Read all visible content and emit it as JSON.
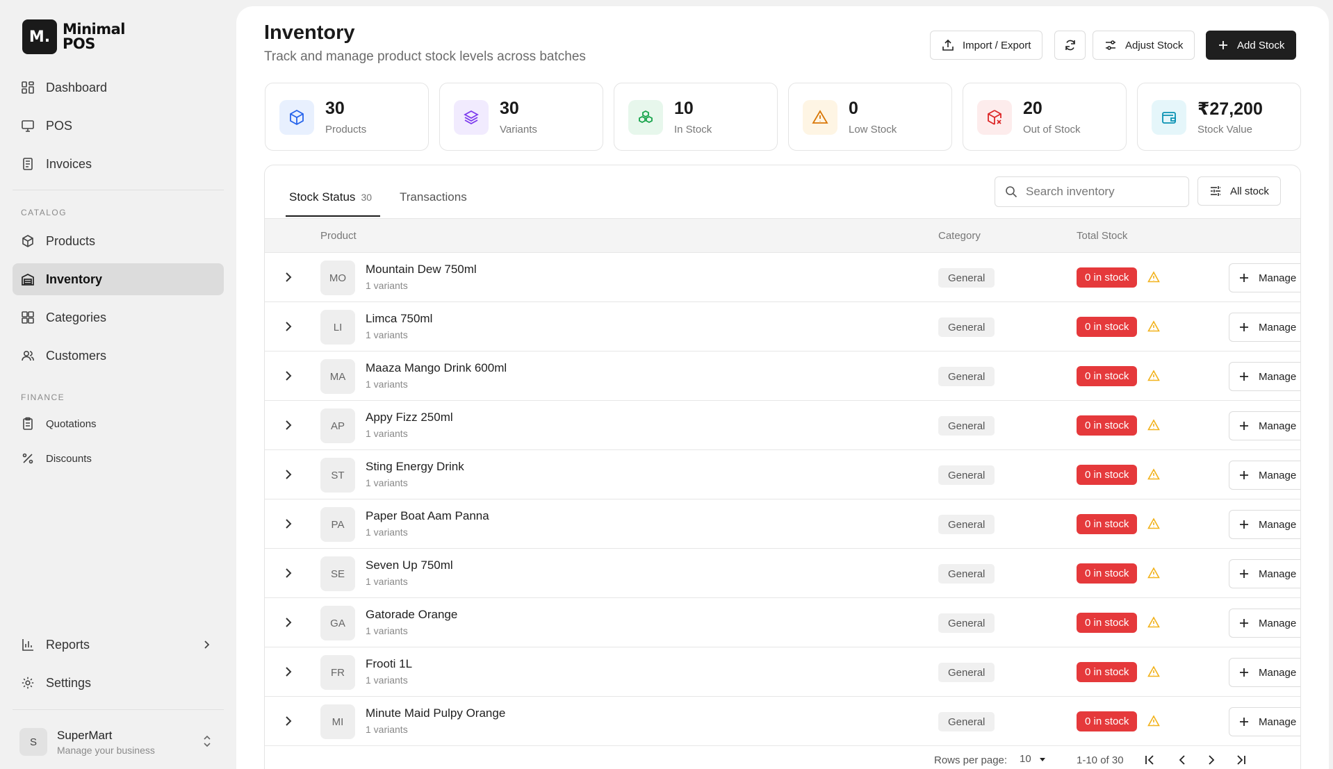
{
  "brand": {
    "logo_mark": "M.",
    "name_line1": "Minimal",
    "name_line2": "POS"
  },
  "sidebar": {
    "primary": [
      {
        "label": "Dashboard",
        "icon": "grid-icon"
      },
      {
        "label": "POS",
        "icon": "monitor-icon"
      },
      {
        "label": "Invoices",
        "icon": "receipt-icon"
      }
    ],
    "catalog_heading": "CATALOG",
    "catalog": [
      {
        "label": "Products",
        "icon": "box-icon"
      },
      {
        "label": "Inventory",
        "icon": "warehouse-icon",
        "active": true
      },
      {
        "label": "Categories",
        "icon": "grid-icon"
      },
      {
        "label": "Customers",
        "icon": "users-icon"
      }
    ],
    "finance_heading": "FINANCE",
    "finance": [
      {
        "label": "Quotations",
        "icon": "clipboard-icon"
      },
      {
        "label": "Discounts",
        "icon": "percent-icon"
      }
    ],
    "bottom": [
      {
        "label": "Reports",
        "icon": "bar-chart-icon"
      },
      {
        "label": "Settings",
        "icon": "gear-icon"
      }
    ],
    "business": {
      "initial": "S",
      "name": "SuperMart",
      "subtitle": "Manage your business"
    }
  },
  "header": {
    "title": "Inventory",
    "subtitle": "Track and manage product stock levels across batches",
    "import_export_label": "Import / Export",
    "adjust_stock_label": "Adjust Stock",
    "add_stock_label": "Add Stock"
  },
  "stats": [
    {
      "value": "30",
      "label": "Products",
      "color": "#2563eb",
      "bg": "#e8f0fe",
      "icon": "cube-icon"
    },
    {
      "value": "30",
      "label": "Variants",
      "color": "#7c3aed",
      "bg": "#f1ebfe",
      "icon": "layers-icon"
    },
    {
      "value": "10",
      "label": "In Stock",
      "color": "#16a34a",
      "bg": "#e7f7ec",
      "icon": "boxes-icon"
    },
    {
      "value": "0",
      "label": "Low Stock",
      "color": "#d97706",
      "bg": "#fef5e4",
      "icon": "alert-triangle-icon"
    },
    {
      "value": "20",
      "label": "Out of Stock",
      "color": "#dc2626",
      "bg": "#fdecec",
      "icon": "package-x-icon"
    },
    {
      "value": "₹27,200",
      "label": "Stock Value",
      "color": "#0891b2",
      "bg": "#e5f6fa",
      "icon": "wallet-icon"
    }
  ],
  "tabs": {
    "stock_status_label": "Stock Status",
    "stock_status_count": "30",
    "transactions_label": "Transactions"
  },
  "search": {
    "placeholder": "Search inventory"
  },
  "filter": {
    "label": "All stock"
  },
  "table": {
    "columns": {
      "product": "Product",
      "category": "Category",
      "total_stock": "Total Stock"
    },
    "manage_label": "Manage",
    "rows": [
      {
        "initials": "MO",
        "name": "Mountain Dew 750ml",
        "variants": "1 variants",
        "category": "General",
        "stock": "0 in stock"
      },
      {
        "initials": "LI",
        "name": "Limca 750ml",
        "variants": "1 variants",
        "category": "General",
        "stock": "0 in stock"
      },
      {
        "initials": "MA",
        "name": "Maaza Mango Drink 600ml",
        "variants": "1 variants",
        "category": "General",
        "stock": "0 in stock"
      },
      {
        "initials": "AP",
        "name": "Appy Fizz 250ml",
        "variants": "1 variants",
        "category": "General",
        "stock": "0 in stock"
      },
      {
        "initials": "ST",
        "name": "Sting Energy Drink",
        "variants": "1 variants",
        "category": "General",
        "stock": "0 in stock"
      },
      {
        "initials": "PA",
        "name": "Paper Boat Aam Panna",
        "variants": "1 variants",
        "category": "General",
        "stock": "0 in stock"
      },
      {
        "initials": "SE",
        "name": "Seven Up 750ml",
        "variants": "1 variants",
        "category": "General",
        "stock": "0 in stock"
      },
      {
        "initials": "GA",
        "name": "Gatorade Orange",
        "variants": "1 variants",
        "category": "General",
        "stock": "0 in stock"
      },
      {
        "initials": "FR",
        "name": "Frooti 1L",
        "variants": "1 variants",
        "category": "General",
        "stock": "0 in stock"
      },
      {
        "initials": "MI",
        "name": "Minute Maid Pulpy Orange",
        "variants": "1 variants",
        "category": "General",
        "stock": "0 in stock"
      }
    ]
  },
  "pagination": {
    "rows_per_page_label": "Rows per page:",
    "rows_per_page": "10",
    "range": "1-10 of 30"
  },
  "colors": {
    "accent_dark": "#1f1f1f",
    "out_of_stock": "#e5393b",
    "warning": "#f2b21b"
  }
}
